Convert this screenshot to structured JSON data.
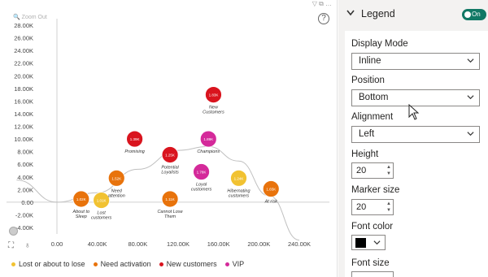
{
  "chart_data": {
    "type": "scatter",
    "xlim": [
      -40000,
      240000
    ],
    "ylim": [
      -6000,
      28000
    ],
    "x_ticks": [
      "0.00",
      "40.00K",
      "80.00K",
      "120.00K",
      "160.00K",
      "200.00K",
      "240.00K"
    ],
    "x_tick_values": [
      0,
      40000,
      80000,
      120000,
      160000,
      200000,
      240000
    ],
    "y_ticks": [
      "28.00K",
      "26.00K",
      "24.00K",
      "22.00K",
      "20.00K",
      "18.00K",
      "16.00K",
      "14.00K",
      "12.00K",
      "10.00K",
      "8.00K",
      "6.00K",
      "4.00K",
      "2.00K",
      "0.00",
      "-2.00K",
      "-4.00K"
    ],
    "y_tick_values": [
      28000,
      26000,
      24000,
      22000,
      20000,
      18000,
      16000,
      14000,
      12000,
      10000,
      8000,
      6000,
      4000,
      2000,
      0,
      -2000,
      -4000
    ],
    "points": [
      {
        "label": "About to Sleep",
        "value_label": "1.02K",
        "x": 24000,
        "y": 500,
        "group": "Need activation"
      },
      {
        "label": "Lost customers",
        "value_label": "1.01K",
        "x": 44000,
        "y": 300,
        "group": "Lost or about to lose"
      },
      {
        "label": "Need attention",
        "value_label": "1.52K",
        "x": 59000,
        "y": 3800,
        "group": "Need activation"
      },
      {
        "label": "Promising",
        "value_label": "1.39K",
        "x": 77000,
        "y": 10000,
        "group": "New customers"
      },
      {
        "label": "Potential Loyalists",
        "value_label": "1.25K",
        "x": 112000,
        "y": 7500,
        "group": "New customers"
      },
      {
        "label": "Cannot Lose Them",
        "value_label": "1.11K",
        "x": 112000,
        "y": 500,
        "group": "Need activation"
      },
      {
        "label": "Loyal customers",
        "value_label": "1.78K",
        "x": 143000,
        "y": 4800,
        "group": "VIP"
      },
      {
        "label": "Champions",
        "value_label": "1.89K",
        "x": 150000,
        "y": 10000,
        "group": "VIP"
      },
      {
        "label": "New Customers",
        "value_label": "1.83K",
        "x": 155000,
        "y": 17000,
        "group": "New customers"
      },
      {
        "label": "Hibernating customers",
        "value_label": "1.24K",
        "x": 180000,
        "y": 3800,
        "group": "Lost or about to lose"
      },
      {
        "label": "At risk",
        "value_label": "1.65K",
        "x": 212000,
        "y": 2100,
        "group": "Need activation"
      }
    ],
    "trend": [
      [
        -40000,
        3500
      ],
      [
        0,
        0
      ],
      [
        40000,
        1500
      ],
      [
        80000,
        5200
      ],
      [
        120000,
        8200
      ],
      [
        150000,
        8800
      ],
      [
        180000,
        6500
      ],
      [
        210000,
        1000
      ],
      [
        240000,
        -6000
      ]
    ],
    "groups": [
      {
        "name": "Lost or about to lose",
        "color": "#f1c232"
      },
      {
        "name": "Need activation",
        "color": "#e8730c"
      },
      {
        "name": "New customers",
        "color": "#d9141e"
      },
      {
        "name": "VIP",
        "color": "#d42a9a"
      }
    ]
  },
  "chart": {
    "zoom_out": "Zoom Out",
    "help": "?"
  },
  "format_pane": {
    "section_title": "Legend",
    "toggle_label": "On",
    "display_mode": {
      "label": "Display Mode",
      "value": "Inline"
    },
    "position": {
      "label": "Position",
      "value": "Bottom"
    },
    "alignment": {
      "label": "Alignment",
      "value": "Left"
    },
    "height": {
      "label": "Height",
      "value": "20"
    },
    "marker_size": {
      "label": "Marker size",
      "value": "20"
    },
    "font_color": {
      "label": "Font color",
      "value": "#000000"
    },
    "font_size": {
      "label": "Font size"
    }
  }
}
